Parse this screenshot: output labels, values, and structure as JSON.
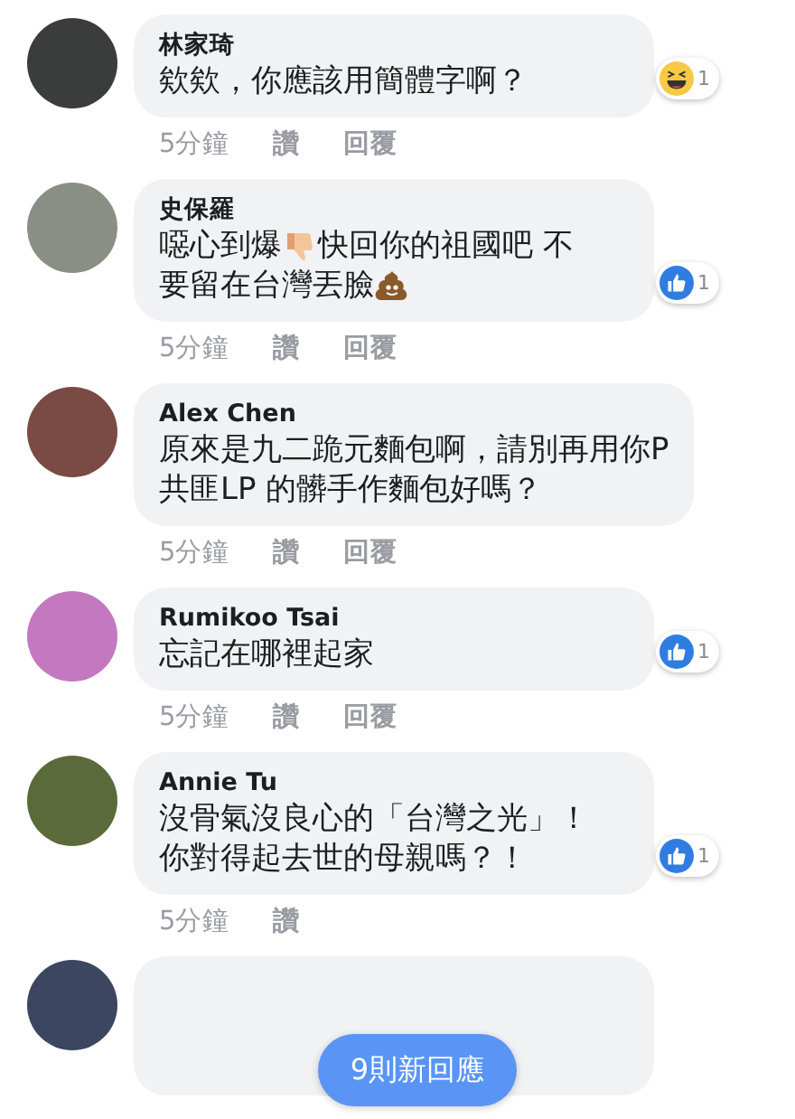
{
  "comments": [
    {
      "author": "林家琦",
      "lines": [
        [
          {
            "kind": "text",
            "text": "欸欸，你應該用簡體字啊？"
          }
        ]
      ],
      "reaction": {
        "kind": "haha",
        "count": "1"
      },
      "actions": [
        "5分鐘",
        "讚",
        "回覆"
      ]
    },
    {
      "author": "史保羅",
      "lines": [
        [
          {
            "kind": "text",
            "text": "噁心到爆 "
          },
          {
            "kind": "thumbs-down"
          },
          {
            "kind": "text",
            "text": " 快回你的祖國吧 不"
          }
        ],
        [
          {
            "kind": "text",
            "text": "要留在台灣丟臉"
          },
          {
            "kind": "poop"
          }
        ]
      ],
      "reaction": {
        "kind": "like",
        "count": "1"
      },
      "actions": [
        "5分鐘",
        "讚",
        "回覆"
      ]
    },
    {
      "author": "Alex Chen",
      "lines": [
        [
          {
            "kind": "text",
            "text": "原來是九二跪元麵包啊，請別再用你P"
          }
        ],
        [
          {
            "kind": "text",
            "text": "共匪LP 的髒手作麵包好嗎？"
          }
        ]
      ],
      "actions": [
        "5分鐘",
        "讚",
        "回覆"
      ]
    },
    {
      "author": "Rumikoo Tsai",
      "lines": [
        [
          {
            "kind": "text",
            "text": "忘記在哪裡起家"
          }
        ]
      ],
      "reaction": {
        "kind": "like",
        "count": "1"
      },
      "actions": [
        "5分鐘",
        "讚",
        "回覆"
      ]
    },
    {
      "author": "Annie Tu",
      "lines": [
        [
          {
            "kind": "text",
            "text": "沒骨氣沒良心的「台灣之光」！"
          }
        ],
        [
          {
            "kind": "text",
            "text": "你對得起去世的母親嗎？！"
          }
        ]
      ],
      "reaction": {
        "kind": "like",
        "count": "1"
      },
      "actions": [
        "5分鐘",
        "讚"
      ]
    },
    {
      "kind": "cut_off"
    }
  ],
  "new_replies_button": "9則新回應"
}
